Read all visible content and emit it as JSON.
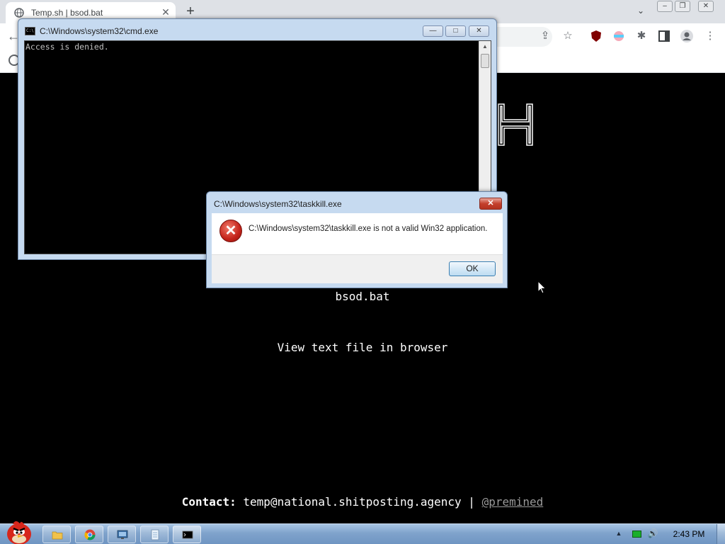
{
  "browser": {
    "tab_title": "Temp.sh | bsod.bat",
    "tab_close": "✕",
    "new_tab": "+",
    "tab_list": "⌄",
    "window_controls": {
      "minimize": "–",
      "restore": "❐",
      "close": "✕"
    }
  },
  "page": {
    "filename": "bsod.bat",
    "view_link": "View text file in browser",
    "contact_label": "Contact:",
    "contact_email": "temp@national.shitposting.agency",
    "contact_separator": "|",
    "contact_handle": "@premined"
  },
  "cmd_window": {
    "title": "C:\\Windows\\system32\\cmd.exe",
    "icon_text": "C:\\",
    "output": "Access is denied.",
    "buttons": {
      "minimize": "—",
      "maximize": "□",
      "close": "✕"
    }
  },
  "error_dialog": {
    "title": "C:\\Windows\\system32\\taskkill.exe",
    "message": "C:\\Windows\\system32\\taskkill.exe is not a valid Win32 application.",
    "icon_glyph": "✕",
    "close": "✕",
    "ok_label": "OK"
  },
  "taskbar": {
    "clock": "2:43 PM",
    "tray_arrow": "▲",
    "volume_glyph": "🔊",
    "items": [
      "explorer",
      "chrome",
      "control-panel",
      "notepad",
      "cmd"
    ]
  },
  "colors": {
    "page_background": "#000000",
    "page_text": "#ffffff",
    "link_muted": "#9a9a9a",
    "aero_frame": "#c6daf0",
    "taskbar": "#7fa3cc",
    "error_red": "#c4231a"
  }
}
